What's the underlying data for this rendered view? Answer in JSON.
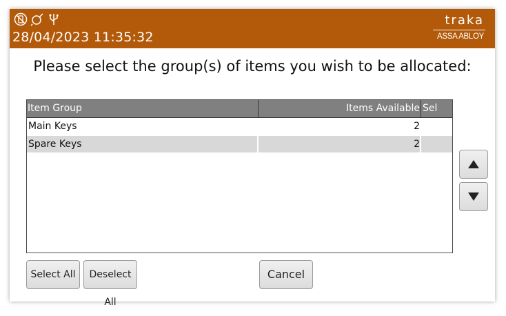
{
  "colors": {
    "header": "#b35a0a",
    "table_header": "#808080"
  },
  "status_icons": [
    "no-phone-icon",
    "plug-icon",
    "usb-icon"
  ],
  "header": {
    "datetime": "28/04/2023 11:35:32"
  },
  "logo": {
    "word": "traka",
    "sub": "ASSA ABLOY"
  },
  "prompt": "Please select the group(s) of items you wish to be allocated:",
  "table": {
    "columns": [
      "Item Group",
      "Items Available",
      "Sel"
    ],
    "rows": [
      {
        "group": "Main Keys",
        "available": "2",
        "sel": ""
      },
      {
        "group": "Spare Keys",
        "available": "2",
        "sel": ""
      }
    ]
  },
  "buttons": {
    "select_all": "Select All",
    "deselect_all": "Deselect All",
    "cancel": "Cancel"
  },
  "scroll": {
    "up_icon": "arrow-up-icon",
    "down_icon": "arrow-down-icon"
  }
}
